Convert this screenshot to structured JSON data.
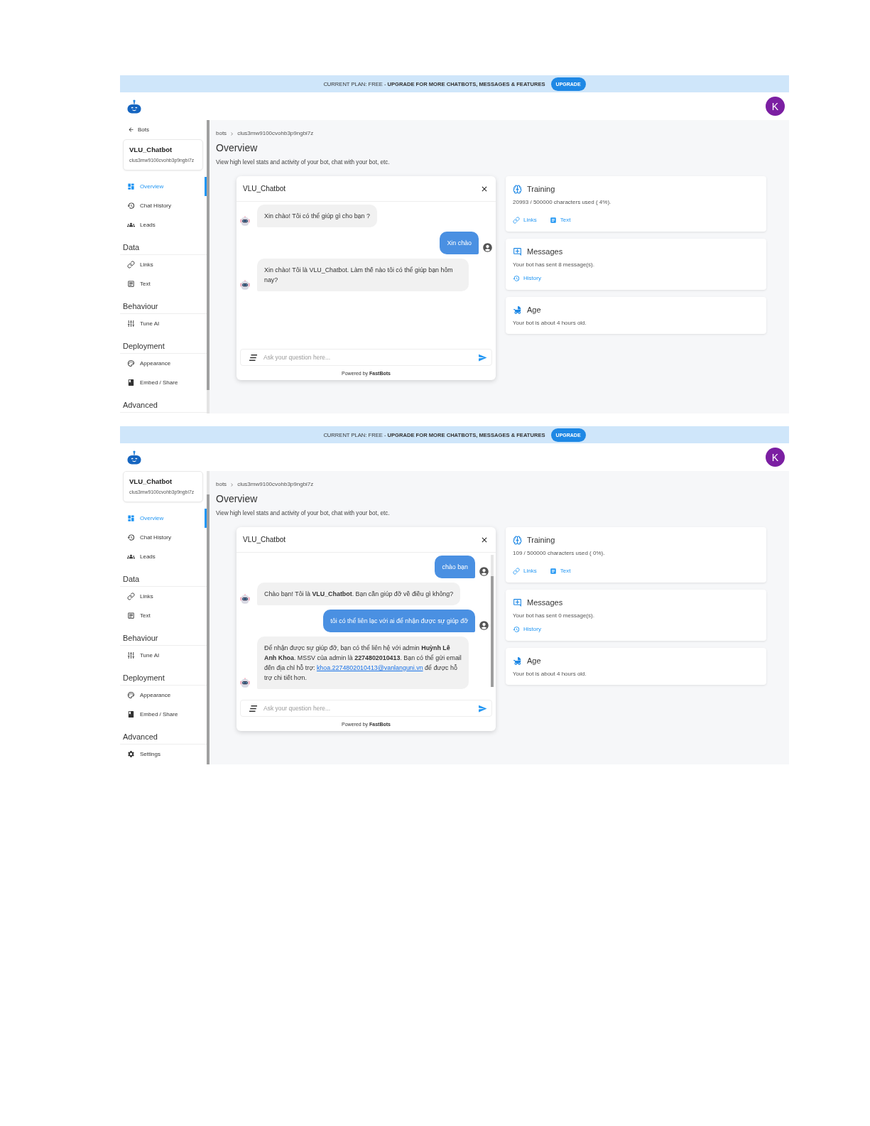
{
  "screens": [
    {
      "banner": {
        "text": "CURRENT PLAN: FREE - **UPGRADE FOR MORE CHATBOTS, MESSAGES & FEATURES**",
        "button": "UPGRADE"
      },
      "header": {
        "avatar": "K"
      },
      "sidebar": {
        "back_link": "Bots",
        "bot": {
          "name": "VLU_Chatbot",
          "id": "clus3mw9100cvohb3p9ngbi7z"
        },
        "sections": [
          {
            "items": [
              {
                "label": "Overview",
                "selected": true
              },
              {
                "label": "Chat History",
                "selected": false
              },
              {
                "label": "Leads",
                "selected": false
              }
            ]
          },
          {
            "heading": "Data",
            "items": [
              {
                "label": "Links",
                "selected": false
              },
              {
                "label": "Text",
                "selected": false
              }
            ]
          },
          {
            "heading": "Behaviour",
            "items": [
              {
                "label": "Tune AI",
                "selected": false
              }
            ]
          },
          {
            "heading": "Deployment",
            "items": [
              {
                "label": "Appearance",
                "selected": false
              },
              {
                "label": "Embed / Share",
                "selected": false
              }
            ]
          },
          {
            "heading": "Advanced"
          }
        ]
      },
      "breadcrumb": [
        "bots",
        "clus3mw9100cvohb3p9ngbi7z"
      ],
      "title": "Overview",
      "subtitle": "View high level stats and activity of your bot, chat with your bot, etc.",
      "chat": {
        "title": "VLU_Chatbot",
        "messages": [
          {
            "kind": "bot",
            "parts": [
              {
                "kind": "text",
                "text": "Xin chào! Tôi có thể giúp gì cho bạn ?"
              }
            ]
          },
          {
            "kind": "user",
            "parts": [
              {
                "kind": "text",
                "text": "Xin chào"
              }
            ]
          },
          {
            "kind": "bot",
            "parts": [
              {
                "kind": "text",
                "text": "Xin chào! Tôi là VLU_Chatbot. Làm thế nào tôi có thể giúp bạn hôm nay?"
              }
            ]
          }
        ],
        "placeholder": "Ask your question here...",
        "footer": "Powered by **FastBots**"
      },
      "training": {
        "title": "Training",
        "text": "20993 / 500000 characters used ( 4%).",
        "links": [
          "Links",
          "Text"
        ]
      },
      "messages": {
        "title": "Messages",
        "text": "Your bot has sent 8 message(s).",
        "links": [
          "History"
        ]
      },
      "age": {
        "title": "Age",
        "text": "Your bot is about 4 hours old."
      }
    },
    {
      "banner": {
        "text": "CURRENT PLAN: FREE - **UPGRADE FOR MORE CHATBOTS, MESSAGES & FEATURES**",
        "button": "UPGRADE"
      },
      "header": {
        "avatar": "K"
      },
      "sidebar": {
        "bot": {
          "name": "VLU_Chatbot",
          "id": "clus3mw9100cvohb3p9ngbi7z"
        },
        "sections": [
          {
            "items": [
              {
                "label": "Overview",
                "selected": true
              },
              {
                "label": "Chat History",
                "selected": false
              },
              {
                "label": "Leads",
                "selected": false
              }
            ]
          },
          {
            "heading": "Data",
            "items": [
              {
                "label": "Links",
                "selected": false
              },
              {
                "label": "Text",
                "selected": false
              }
            ]
          },
          {
            "heading": "Behaviour",
            "items": [
              {
                "label": "Tune AI",
                "selected": false
              }
            ]
          },
          {
            "heading": "Deployment",
            "items": [
              {
                "label": "Appearance",
                "selected": false
              },
              {
                "label": "Embed / Share",
                "selected": false
              }
            ]
          },
          {
            "heading": "Advanced",
            "items": [
              {
                "label": "Settings",
                "selected": false
              }
            ]
          }
        ]
      },
      "breadcrumb": [
        "bots",
        "clus3mw9100cvohb3p9ngbi7z"
      ],
      "title": "Overview",
      "subtitle": "View high level stats and activity of your bot, chat with your bot, etc.",
      "chat": {
        "title": "VLU_Chatbot",
        "messages": [
          {
            "kind": "user",
            "parts": [
              {
                "kind": "text",
                "text": "chào bạn"
              }
            ]
          },
          {
            "kind": "bot",
            "parts": [
              {
                "kind": "text",
                "text": "Chào bạn! Tôi là **VLU_Chatbot**. Bạn cần giúp đỡ về điều gì không?"
              }
            ]
          },
          {
            "kind": "user",
            "parts": [
              {
                "kind": "text",
                "text": "tôi có thể liên lạc với ai để nhận được sự giúp đỡ"
              }
            ]
          },
          {
            "kind": "bot",
            "parts": [
              {
                "kind": "text",
                "text": "Để nhận được sự giúp đỡ, bạn có thể liên hệ với admin **Huỳnh Lê Anh Khoa**. MSSV của admin là **2274802010413**. Bạn có thể gửi email đến địa chỉ hỗ trợ: "
              },
              {
                "kind": "link",
                "text": "khoa.2274802010413@vanlanguni.vn"
              },
              {
                "kind": "text",
                "text": " để được hỗ trợ chi tiết hơn."
              }
            ]
          }
        ],
        "placeholder": "Ask your question here...",
        "footer": "Powered by **FastBots**"
      },
      "training": {
        "title": "Training",
        "text": "109 / 500000 characters used ( 0%).",
        "links": [
          "Links",
          "Text"
        ]
      },
      "messages": {
        "title": "Messages",
        "text": "Your bot has sent 0 message(s).",
        "links": [
          "History"
        ]
      },
      "age": {
        "title": "Age",
        "text": "Your bot is about 4 hours old."
      }
    }
  ]
}
